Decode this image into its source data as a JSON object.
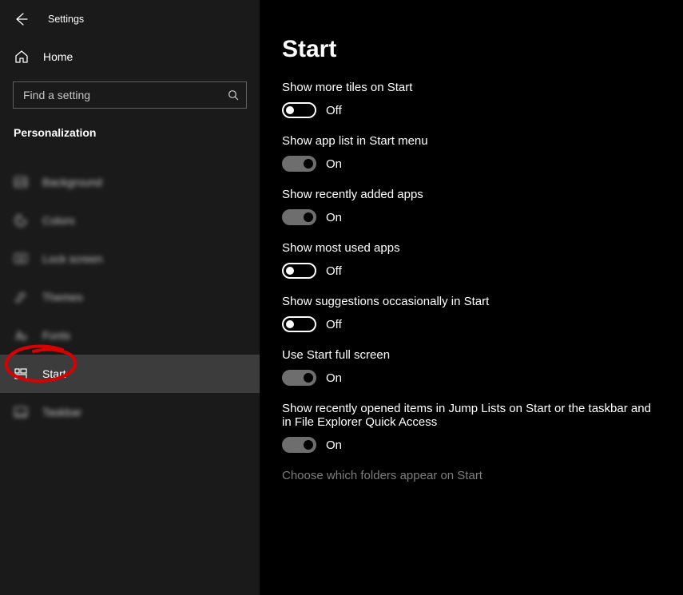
{
  "window": {
    "title": "Settings"
  },
  "sidebar": {
    "home": "Home",
    "search_placeholder": "Find a setting",
    "category": "Personalization",
    "items": [
      {
        "label": "Background",
        "icon": "background-icon"
      },
      {
        "label": "Colors",
        "icon": "colors-icon"
      },
      {
        "label": "Lock screen",
        "icon": "lockscreen-icon"
      },
      {
        "label": "Themes",
        "icon": "themes-icon"
      },
      {
        "label": "Fonts",
        "icon": "fonts-icon"
      },
      {
        "label": "Start",
        "icon": "start-icon"
      },
      {
        "label": "Taskbar",
        "icon": "taskbar-icon"
      }
    ],
    "active_index": 5
  },
  "page": {
    "title": "Start",
    "settings": [
      {
        "label": "Show more tiles on Start",
        "on": false,
        "state": "Off"
      },
      {
        "label": "Show app list in Start menu",
        "on": true,
        "state": "On"
      },
      {
        "label": "Show recently added apps",
        "on": true,
        "state": "On"
      },
      {
        "label": "Show most used apps",
        "on": false,
        "state": "Off"
      },
      {
        "label": "Show suggestions occasionally in Start",
        "on": false,
        "state": "Off"
      },
      {
        "label": "Use Start full screen",
        "on": true,
        "state": "On"
      },
      {
        "label": "Show recently opened items in Jump Lists on Start or the taskbar and in File Explorer Quick Access",
        "on": true,
        "state": "On"
      }
    ],
    "link": "Choose which folders appear on Start"
  },
  "annotation": {
    "circled_item": "Start"
  }
}
